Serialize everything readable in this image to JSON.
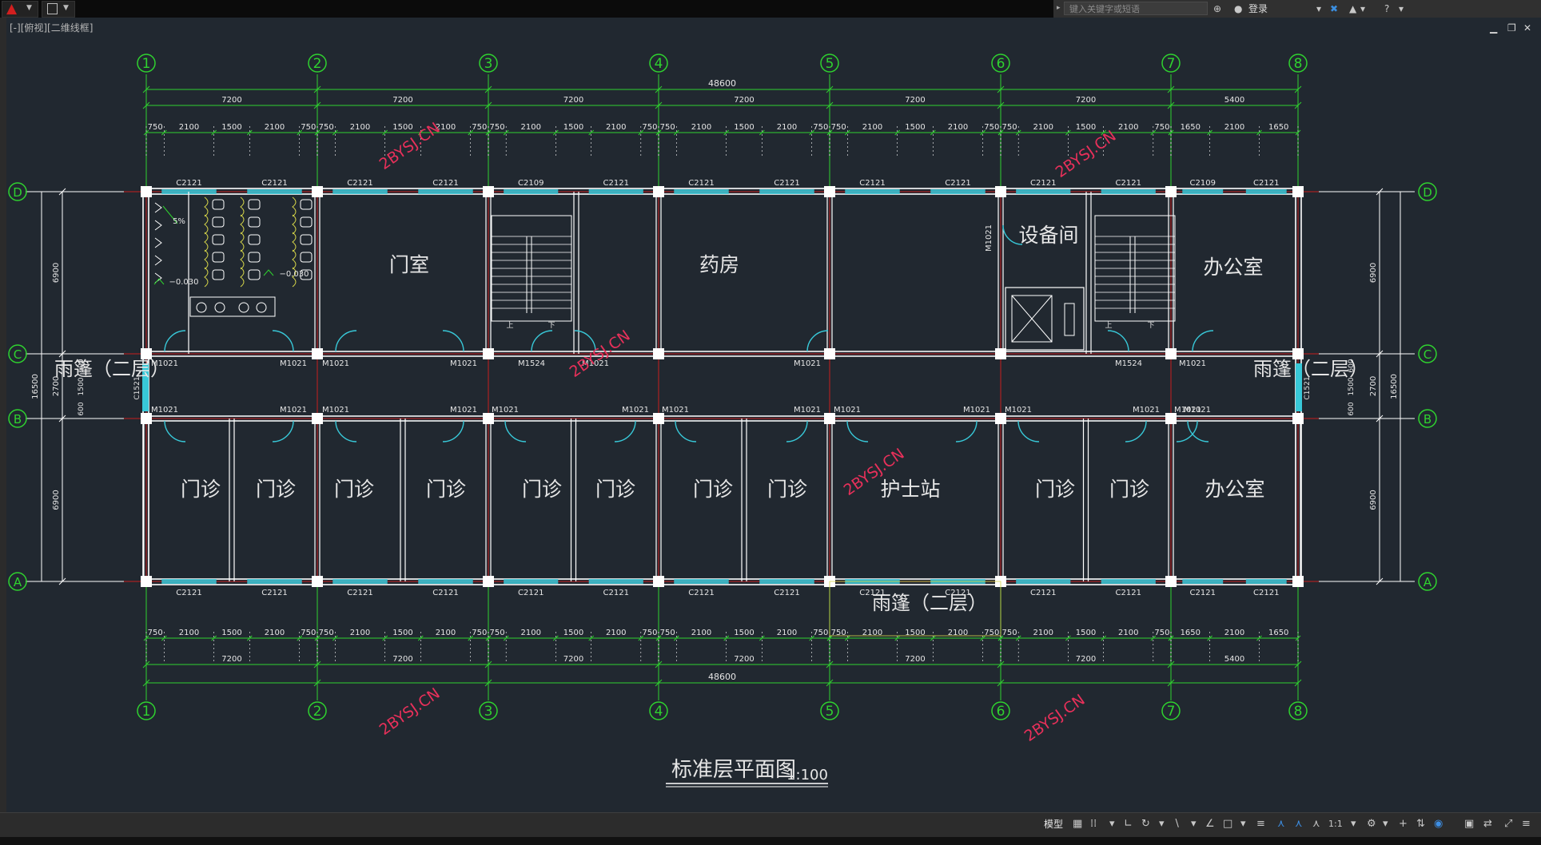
{
  "app": {
    "search_placeholder": "键入关键字或短语",
    "login": "登录",
    "viewport_label": "[-][俯视][二维线框]",
    "model_tab": "模型",
    "scale": "1:1"
  },
  "colors": {
    "canvas": "#212830",
    "grid_bubble": "#2fd22f",
    "dimension": "#2fd22f",
    "wall": "#ffffff",
    "axis_line": "#c81e1e",
    "window": "#38c8d8",
    "door": "#38c8d8",
    "watermark": "#e8305a",
    "text": "#e6e6e6"
  },
  "drawing": {
    "title": "标准层平面图",
    "scale": "1:100",
    "axes_numbers": [
      "1",
      "2",
      "3",
      "4",
      "5",
      "6",
      "7",
      "8"
    ],
    "axes_letters": [
      "D",
      "C",
      "B",
      "A"
    ],
    "top_total": "48600",
    "bottom_total": "48600",
    "bay_dims": [
      "7200",
      "7200",
      "7200",
      "7200",
      "7200",
      "7200",
      "5400"
    ],
    "sub_dims": [
      [
        "750",
        "2100",
        "1500",
        "2100",
        "750"
      ],
      [
        "750",
        "2100",
        "1500",
        "2100",
        "750"
      ],
      [
        "750",
        "2100",
        "1500",
        "2100",
        "750"
      ],
      [
        "750",
        "2100",
        "1500",
        "2100",
        "750"
      ],
      [
        "750",
        "2100",
        "1500",
        "2100",
        "750"
      ],
      [
        "750",
        "2100",
        "1500",
        "2100",
        "750"
      ],
      [
        "1650",
        "2100",
        "1650"
      ]
    ],
    "side_dims": {
      "d_c": "6900",
      "c_b": "2700",
      "b_a": "6900",
      "total": "16500",
      "corridor_parts": [
        "600",
        "1500",
        "600"
      ]
    },
    "top_windows": [
      "C2121",
      "C2121",
      "C2121",
      "C2121",
      "C2109",
      "C2121",
      "C2121",
      "C2121",
      "C2121",
      "C2121",
      "C2121",
      "C2121",
      "C2109",
      "C2121"
    ],
    "bottom_windows": [
      "C2121",
      "C2121",
      "C2121",
      "C2121",
      "C2121",
      "C2121",
      "C2121",
      "C2121",
      "C2121",
      "C2121",
      "C2121",
      "C2121",
      "C2121",
      "C2121"
    ],
    "side_windows": [
      "C1521",
      "C1521"
    ],
    "c_doors": [
      "M1021",
      "M1021",
      "M1021",
      "M1021",
      "M1524",
      "M1021",
      "M1021",
      "M1524",
      "M1021"
    ],
    "b_doors": [
      "M1021",
      "M1021",
      "M1021",
      "M1021",
      "M1021",
      "M1021",
      "M1021",
      "M1021",
      "M1021",
      "M1021",
      "M1021",
      "M1021",
      "M1021",
      "M1021"
    ],
    "equipment_door": "M1021",
    "rooms_north": [
      {
        "name": "门室"
      },
      {
        "name": "药房"
      },
      {
        "name": "设备间"
      },
      {
        "name": "办公室"
      }
    ],
    "rooms_south": [
      {
        "name": "门诊"
      },
      {
        "name": "门诊"
      },
      {
        "name": "门诊"
      },
      {
        "name": "门诊"
      },
      {
        "name": "门诊"
      },
      {
        "name": "门诊"
      },
      {
        "name": "门诊"
      },
      {
        "name": "门诊"
      },
      {
        "name": "护士站"
      },
      {
        "name": "门诊"
      },
      {
        "name": "门诊"
      },
      {
        "name": "办公室"
      }
    ],
    "canopies": [
      "雨篷（二层）",
      "雨篷（二层）",
      "雨篷（二层）"
    ],
    "stair_up": "上",
    "stair_down": "下",
    "slope": "5%",
    "elevations": [
      "−0.030",
      "−0.030"
    ],
    "watermark": "2BYSJ.CN"
  }
}
